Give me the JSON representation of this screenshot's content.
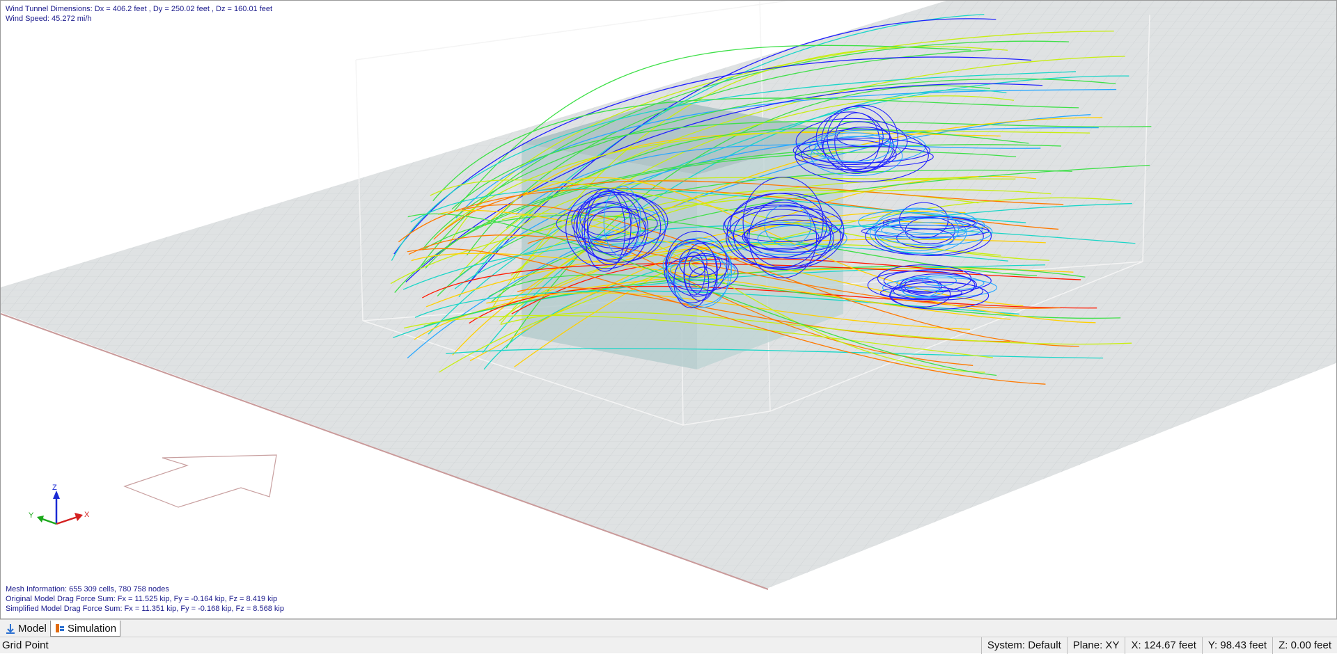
{
  "overlay_top": {
    "line1": "Wind Tunnel Dimensions: Dx = 406.2 feet , Dy = 250.02 feet , Dz = 160.01 feet",
    "line2": "Wind Speed: 45.272 mi/h"
  },
  "overlay_bottom": {
    "mesh": "Mesh Information: 655 309 cells, 780 758 nodes",
    "original": "Original Model Drag Force Sum: Fx = 11.525 kip, Fy = -0.164 kip, Fz = 8.419 kip",
    "simplified": "Simplified Model Drag Force Sum: Fx = 11.351 kip, Fy = -0.168 kip, Fz = 8.568 kip"
  },
  "axes": {
    "x": "X",
    "y": "Y",
    "z": "Z"
  },
  "axis_colors": {
    "x": "#d42020",
    "y": "#1aa81a",
    "z": "#1a2ad4"
  },
  "tabs": [
    {
      "label": "Model",
      "icon": "model-icon",
      "active": false
    },
    {
      "label": "Simulation",
      "icon": "simulation-icon",
      "active": true
    }
  ],
  "status": {
    "left": "Grid Point",
    "system": "System: Default",
    "plane": "Plane: XY",
    "x": "X:  124.67 feet",
    "y": "Y:  98.43 feet",
    "z": "Z:  0.00 feet"
  },
  "streamline_palette": [
    "#ff1a00",
    "#ff7a00",
    "#ffd000",
    "#c8ee10",
    "#3ee048",
    "#1ad6c8",
    "#2aa8ff",
    "#2020ff",
    "#0000c8"
  ]
}
